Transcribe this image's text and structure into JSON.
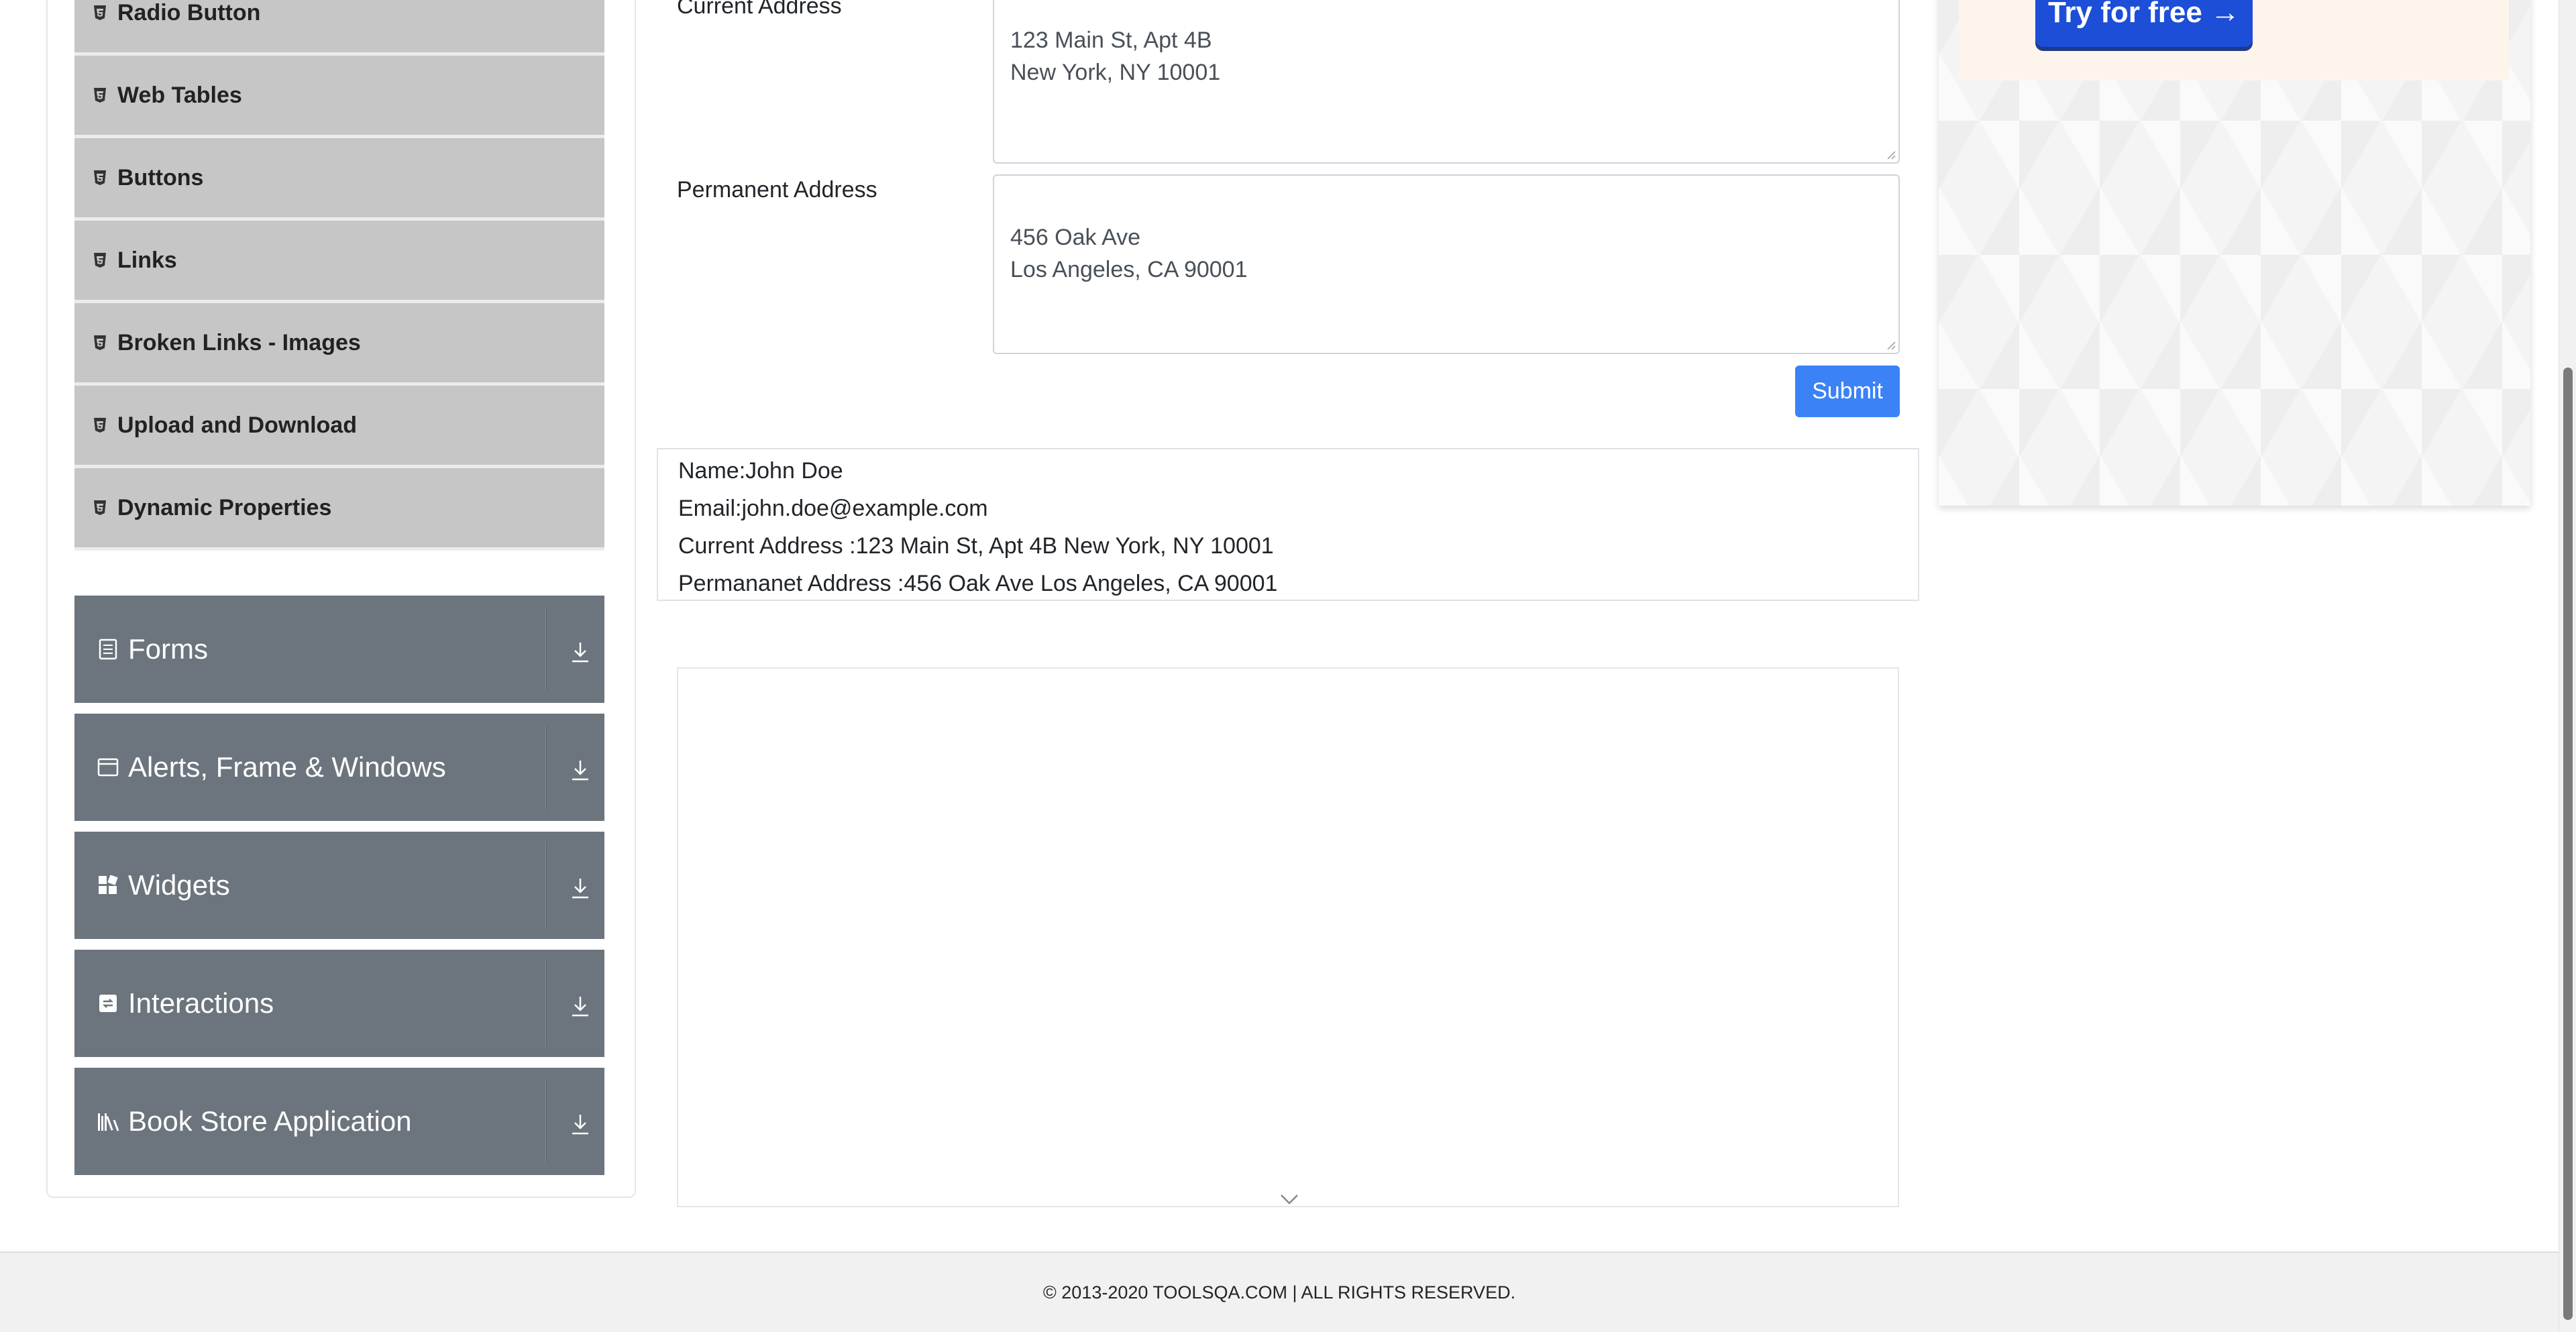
{
  "sidebar": {
    "elements_items": [
      {
        "label": "Radio Button"
      },
      {
        "label": "Web Tables"
      },
      {
        "label": "Buttons"
      },
      {
        "label": "Links"
      },
      {
        "label": "Broken Links - Images"
      },
      {
        "label": "Upload and Download"
      },
      {
        "label": "Dynamic Properties"
      }
    ],
    "groups": [
      {
        "label": "Forms",
        "icon": "form-icon"
      },
      {
        "label": "Alerts, Frame & Windows",
        "icon": "window-icon"
      },
      {
        "label": "Widgets",
        "icon": "widgets-icon"
      },
      {
        "label": "Interactions",
        "icon": "interactions-icon"
      },
      {
        "label": "Book Store Application",
        "icon": "books-icon"
      }
    ]
  },
  "form": {
    "current_address_label": "Current Address",
    "current_address_value": "123 Main St, Apt 4B\nNew York, NY 10001",
    "permanent_address_label": "Permanent Address",
    "permanent_address_value": "456 Oak Ave\nLos Angeles, CA 90001",
    "submit_label": "Submit"
  },
  "output": {
    "name": "Name:John Doe",
    "email": "Email:john.doe@example.com",
    "current_address": "Current Address :123 Main St, Apt 4B New York, NY 10001",
    "permanent_address": "Permananet Address :456 Oak Ave Los Angeles, CA 90001"
  },
  "ad": {
    "button_label": "Try for free →"
  },
  "footer": {
    "text": "© 2013-2020 TOOLSQA.COM | ALL RIGHTS RESERVED."
  }
}
